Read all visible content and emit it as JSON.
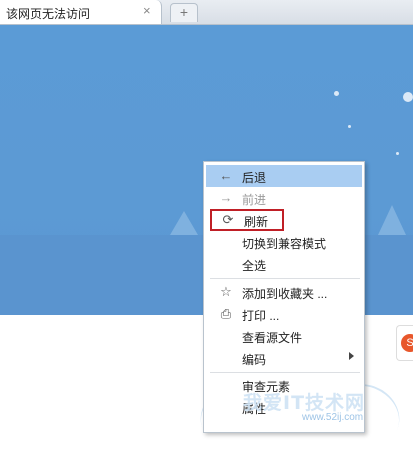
{
  "tab": {
    "title": "该网页无法访问",
    "close_glyph": "×",
    "new_tab_glyph": "+"
  },
  "context_menu": {
    "items": [
      {
        "label": "后退",
        "icon": "arrow-left-icon",
        "glyph": "←",
        "state": "highlighted"
      },
      {
        "label": "前进",
        "icon": "arrow-right-icon",
        "glyph": "→",
        "state": "disabled"
      },
      {
        "label": "刷新",
        "icon": "refresh-icon",
        "glyph": "⟳",
        "state": "boxed"
      },
      {
        "label": "切换到兼容模式",
        "icon": "",
        "glyph": "",
        "state": "normal"
      },
      {
        "label": "全选",
        "icon": "",
        "glyph": "",
        "state": "normal"
      },
      {
        "label": "添加到收藏夹 ...",
        "icon": "star-icon",
        "glyph": "☆",
        "state": "normal"
      },
      {
        "label": "打印 ...",
        "icon": "printer-icon",
        "glyph": "⎙",
        "state": "normal"
      },
      {
        "label": "查看源文件",
        "icon": "",
        "glyph": "",
        "state": "normal"
      },
      {
        "label": "编码",
        "icon": "",
        "glyph": "",
        "state": "submenu"
      },
      {
        "label": "审查元素",
        "icon": "",
        "glyph": "",
        "state": "normal"
      },
      {
        "label": "属性",
        "icon": "",
        "glyph": "",
        "state": "normal"
      }
    ]
  },
  "side_widget": {
    "glyph": "S"
  },
  "watermark": {
    "title": "我爱IT技术网",
    "url": "www.52ij.com"
  },
  "colors": {
    "sky": "#5b9bd6",
    "highlight": "#a9cdf2",
    "box_border": "#c01f26"
  }
}
